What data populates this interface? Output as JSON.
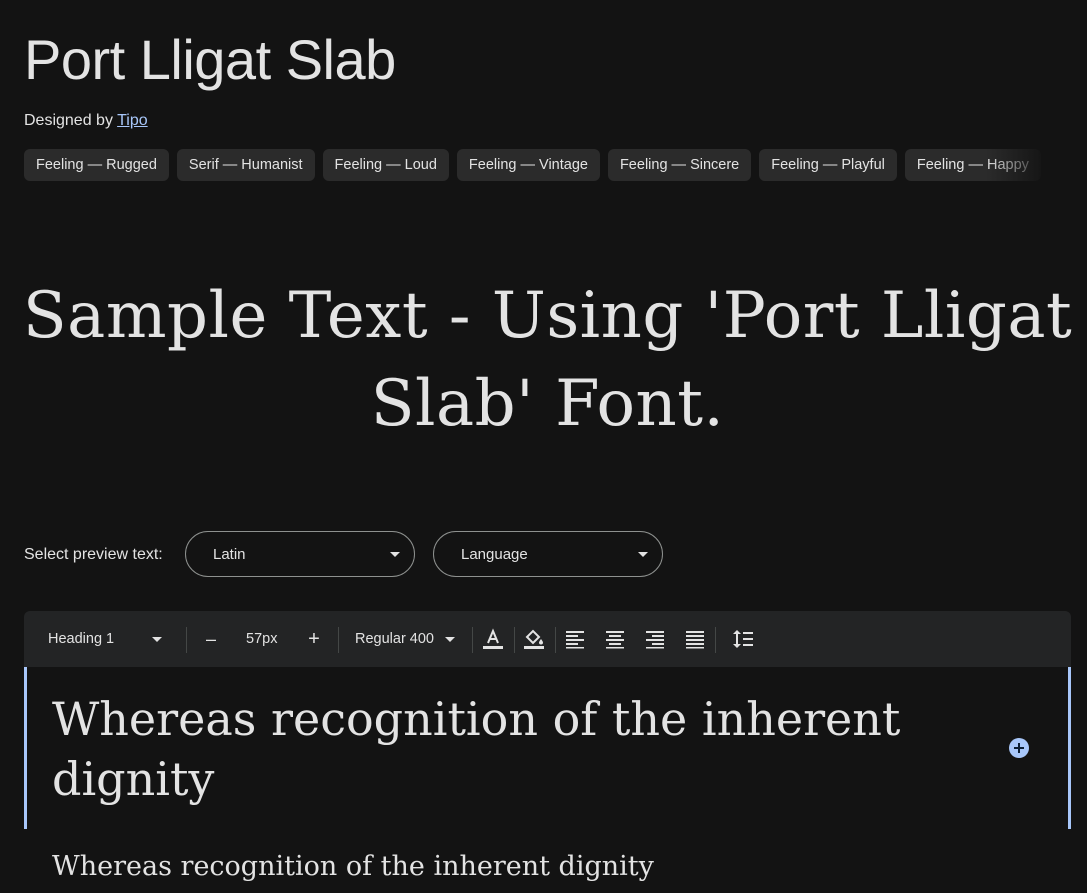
{
  "font": {
    "title": "Port Lligat Slab",
    "designed_by_label": "Designed by",
    "designer": "Tipo"
  },
  "tags": [
    "Feeling — Rugged",
    "Serif — Humanist",
    "Feeling — Loud",
    "Feeling — Vintage",
    "Feeling — Sincere",
    "Feeling — Playful",
    "Feeling — Happy"
  ],
  "sample_text": "Sample Text - Using 'Port Lligat Slab' Font.",
  "preview": {
    "label": "Select preview text:",
    "script_select": "Latin",
    "language_select": "Language"
  },
  "toolbar": {
    "style_select": "Heading 1",
    "decrease_symbol": "–",
    "size_value": "57px",
    "increase_symbol": "+",
    "weight_select": "Regular 400"
  },
  "editor": {
    "heading_text": "Whereas recognition of the inherent dignity",
    "second_text": "Whereas recognition of the inherent dignity"
  },
  "colors": {
    "background": "#131313",
    "text": "#e3e3e3",
    "accent": "#a8c7fa",
    "chip": "#2b2b2b",
    "toolbar": "#232425"
  },
  "icons": [
    "text-color-icon",
    "highlight-color-icon",
    "align-left-icon",
    "align-center-icon",
    "align-right-icon",
    "align-justify-icon",
    "line-height-icon",
    "add-circle-icon",
    "chevron-down-icon"
  ]
}
